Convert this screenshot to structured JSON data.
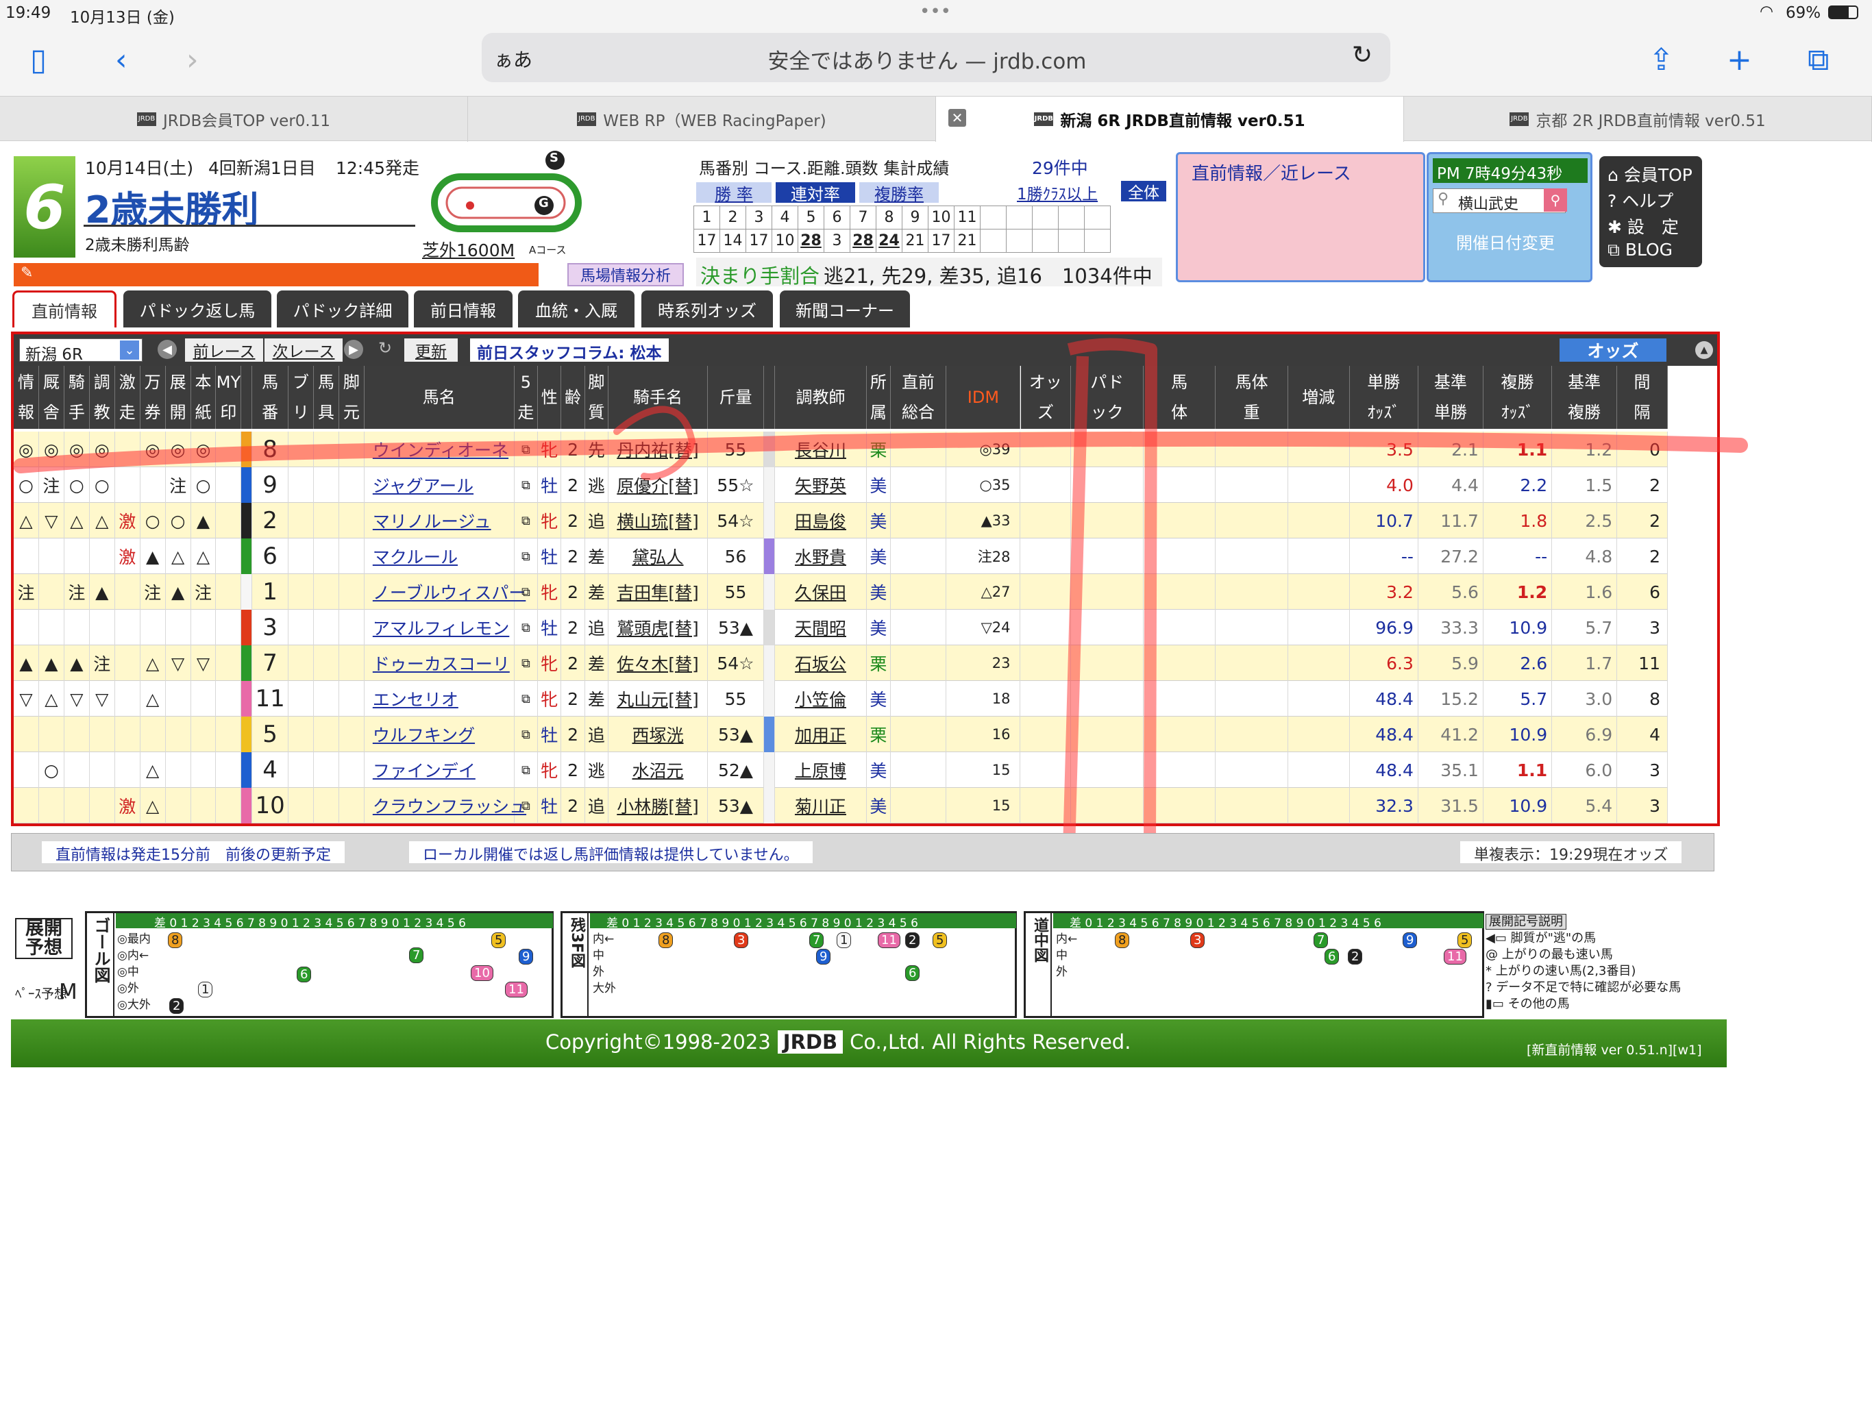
{
  "status": {
    "time": "19:49",
    "date": "10月13日 (金)",
    "battery": "69%",
    "dots": "•••"
  },
  "browser": {
    "aa": "ぁあ",
    "url": "安全ではありません — jrdb.com"
  },
  "tabs": [
    {
      "label": "JRDB会員TOP ver0.11"
    },
    {
      "label": "WEB RP（WEB RacingPaper)"
    },
    {
      "label": "新潟 6R JRDB直前情報 ver0.51"
    },
    {
      "label": "京都 2R JRDB直前情報 ver0.51"
    }
  ],
  "race": {
    "number": "6",
    "date_line": "10月14日(土)",
    "kai": "4回新潟1日目",
    "post": "12:45発走",
    "title": "2歳未勝利",
    "subtitle": "2歳未勝利馬齢",
    "course": "芝外1600M",
    "course_sub": "Aコース",
    "badge_s": "S",
    "badge_g": "G"
  },
  "stats": {
    "title": "馬番別 コース.距離.頭数 集計成績",
    "count": "29件中",
    "tab1": "勝 率",
    "tab2": "連対率",
    "tab3": "複勝率",
    "filter": "1勝ｸﾗｽ以上",
    "all": "全体",
    "row1": [
      "1",
      "2",
      "3",
      "4",
      "5",
      "6",
      "7",
      "8",
      "9",
      "10",
      "11",
      "",
      "",
      "",
      "",
      ""
    ],
    "row2": [
      "17",
      "14",
      "17",
      "10",
      "28",
      "3",
      "28",
      "24",
      "21",
      "17",
      "21",
      "",
      "",
      "",
      "",
      ""
    ],
    "analysis": "馬場情報分析",
    "kimarite": "決まり手割合",
    "kimarite_vals": "逃21, 先29, 差35, 追16　1034件中"
  },
  "side": {
    "pink_title": "直前情報／近レース",
    "clock": "PM 7時49分43秒",
    "search_value": "横山武史",
    "date_change": "開催日付変更",
    "menu": [
      "会員TOP",
      "ヘルプ",
      "設　定",
      "BLOG"
    ]
  },
  "page_tabs": [
    "直前情報",
    "パドック返し馬",
    "パドック詳細",
    "前日情報",
    "血統・入厩",
    "時系列オッズ",
    "新聞コーナー"
  ],
  "controls": {
    "race_select": "新潟 6R",
    "prev": "前レース",
    "next": "次レース",
    "refresh": "更新",
    "column": "前日スタッフコラム: 松本",
    "odds": "オッズ"
  },
  "headers": [
    [
      "情",
      "報"
    ],
    [
      "厩",
      "舎"
    ],
    [
      "騎",
      "手"
    ],
    [
      "調",
      "教"
    ],
    [
      "激",
      "走"
    ],
    [
      "万",
      "券"
    ],
    [
      "展",
      "開"
    ],
    [
      "本",
      "紙"
    ],
    [
      "MY",
      "印"
    ],
    [
      "",
      ""
    ],
    [
      "馬",
      "番"
    ],
    [
      "ブ",
      "リ"
    ],
    [
      "馬",
      "具"
    ],
    [
      "脚",
      "元"
    ],
    [
      "馬名",
      ""
    ],
    [
      "5",
      "走"
    ],
    [
      "性",
      ""
    ],
    [
      "齢",
      ""
    ],
    [
      "脚",
      "質"
    ],
    [
      "騎手名",
      ""
    ],
    [
      "斤量",
      ""
    ],
    [
      "",
      ""
    ],
    [
      "調教師",
      ""
    ],
    [
      "所",
      "属"
    ],
    [
      "直前",
      "総合"
    ],
    [
      "IDM",
      ""
    ],
    [
      "オッ",
      "ズ"
    ],
    [
      "パド",
      "ック"
    ],
    [
      "馬",
      "体"
    ],
    [
      "馬体",
      "重"
    ],
    [
      "増減",
      ""
    ],
    [
      "単勝",
      "ｵｯｽﾞ"
    ],
    [
      "基準",
      "単勝"
    ],
    [
      "複勝",
      "ｵｯｽﾞ"
    ],
    [
      "基準",
      "複勝"
    ],
    [
      "間",
      "隔"
    ]
  ],
  "horses": [
    {
      "marks": [
        "◎",
        "◎",
        "◎",
        "◎",
        "",
        "◎",
        "◎",
        "◎",
        ""
      ],
      "color": "#f0a020",
      "num": "8",
      "name": "ウインディオーネ",
      "sex": "牝",
      "age": "2",
      "style": "先",
      "jockey": "丹内祐[替]",
      "weight": "55",
      "tcolor": "#dcdcdc",
      "trainer": "長谷川",
      "affil": "栗",
      "idm": "◎39",
      "win": "3.5",
      "bwin": "2.1",
      "place": "1.1",
      "bplace": "1.2",
      "gap": "0"
    },
    {
      "marks": [
        "○",
        "注",
        "○",
        "○",
        "",
        "",
        "注",
        "○",
        ""
      ],
      "color": "#1e5fd0",
      "num": "9",
      "name": "ジャグアール",
      "sex": "牡",
      "age": "2",
      "style": "逃",
      "jockey": "原優介[替]",
      "weight": "55☆",
      "tcolor": "#f4f4f4",
      "trainer": "矢野英",
      "affil": "美",
      "idm": "○35",
      "win": "4.0",
      "bwin": "4.4",
      "place": "2.2",
      "bplace": "1.5",
      "gap": "2"
    },
    {
      "marks": [
        "△",
        "▽",
        "△",
        "△",
        "激",
        "○",
        "○",
        "▲",
        ""
      ],
      "color": "#222222",
      "num": "2",
      "name": "マリノルージュ",
      "sex": "牝",
      "age": "2",
      "style": "追",
      "jockey": "横山琉[替]",
      "weight": "54☆",
      "tcolor": "#f4f4f4",
      "trainer": "田島俊",
      "affil": "美",
      "idm": "▲33",
      "win": "10.7",
      "bwin": "11.7",
      "place": "1.8",
      "bplace": "2.5",
      "gap": "2"
    },
    {
      "marks": [
        "",
        "",
        "",
        "",
        "激",
        "▲",
        "△",
        "△",
        ""
      ],
      "color": "#2a9a2a",
      "num": "6",
      "name": "マクルール",
      "sex": "牡",
      "age": "2",
      "style": "差",
      "jockey": "黛弘人",
      "weight": "56",
      "tcolor": "#9b7fe0",
      "trainer": "水野貴",
      "affil": "美",
      "idm": "注28",
      "win": "--",
      "bwin": "27.2",
      "place": "--",
      "bplace": "4.8",
      "gap": "2"
    },
    {
      "marks": [
        "注",
        "",
        "注",
        "▲",
        "",
        "注",
        "▲",
        "注",
        ""
      ],
      "color": "#f6f6f6",
      "num": "1",
      "name": "ノーブルウィスパー",
      "sex": "牝",
      "age": "2",
      "style": "差",
      "jockey": "吉田隼[替]",
      "weight": "55",
      "tcolor": "#f4f4f4",
      "trainer": "久保田",
      "affil": "美",
      "idm": "△27",
      "win": "3.2",
      "bwin": "5.6",
      "place": "1.2",
      "bplace": "1.6",
      "gap": "6"
    },
    {
      "marks": [
        "",
        "",
        "",
        "",
        "",
        "",
        "",
        "",
        ""
      ],
      "color": "#e03a1a",
      "num": "3",
      "name": "アマルフィレモン",
      "sex": "牡",
      "age": "2",
      "style": "追",
      "jockey": "鷲頭虎[替]",
      "weight": "53▲",
      "tcolor": "#dcdcdc",
      "trainer": "天間昭",
      "affil": "美",
      "idm": "▽24",
      "win": "96.9",
      "bwin": "33.3",
      "place": "10.9",
      "bplace": "5.7",
      "gap": "3"
    },
    {
      "marks": [
        "▲",
        "▲",
        "▲",
        "注",
        "",
        "△",
        "▽",
        "▽",
        ""
      ],
      "color": "#2a9a2a",
      "num": "7",
      "name": "ドゥーカスコーリ",
      "sex": "牝",
      "age": "2",
      "style": "差",
      "jockey": "佐々木[替]",
      "weight": "54☆",
      "tcolor": "#f4f4f4",
      "trainer": "石坂公",
      "affil": "栗",
      "idm": "23",
      "win": "6.3",
      "bwin": "5.9",
      "place": "2.6",
      "bplace": "1.7",
      "gap": "11"
    },
    {
      "marks": [
        "▽",
        "△",
        "▽",
        "▽",
        "",
        "△",
        "",
        "",
        ""
      ],
      "color": "#e86aa8",
      "num": "11",
      "name": "エンセリオ",
      "sex": "牝",
      "age": "2",
      "style": "差",
      "jockey": "丸山元[替]",
      "weight": "55",
      "tcolor": "#f4f4f4",
      "trainer": "小笠倫",
      "affil": "美",
      "idm": "18",
      "win": "48.4",
      "bwin": "15.2",
      "place": "5.7",
      "bplace": "3.0",
      "gap": "8"
    },
    {
      "marks": [
        "",
        "",
        "",
        "",
        "",
        "",
        "",
        "",
        ""
      ],
      "color": "#f0c020",
      "num": "5",
      "name": "ウルフキング",
      "sex": "牡",
      "age": "2",
      "style": "追",
      "jockey": "西塚洸",
      "weight": "53▲",
      "tcolor": "#5b8de0",
      "trainer": "加用正",
      "affil": "栗",
      "idm": "16",
      "win": "48.4",
      "bwin": "41.2",
      "place": "10.9",
      "bplace": "6.9",
      "gap": "4"
    },
    {
      "marks": [
        "",
        "○",
        "",
        "",
        "",
        "△",
        "",
        "",
        ""
      ],
      "color": "#1e5fd0",
      "num": "4",
      "name": "ファインデイ",
      "sex": "牝",
      "age": "2",
      "style": "逃",
      "jockey": "水沼元",
      "weight": "52▲",
      "tcolor": "#f4f4f4",
      "trainer": "上原博",
      "affil": "美",
      "idm": "15",
      "win": "48.4",
      "bwin": "35.1",
      "place": "1.1",
      "bplace": "6.0",
      "gap": "3"
    },
    {
      "marks": [
        "",
        "",
        "",
        "",
        "激",
        "△",
        "",
        "",
        ""
      ],
      "color": "#e86aa8",
      "num": "10",
      "name": "クラウンフラッシュ",
      "sex": "牡",
      "age": "2",
      "style": "追",
      "jockey": "小林勝[替]",
      "weight": "53▲",
      "tcolor": "#f4f4f4",
      "trainer": "菊川正",
      "affil": "美",
      "idm": "15",
      "win": "32.3",
      "bwin": "31.5",
      "place": "10.9",
      "bplace": "5.4",
      "gap": "3"
    }
  ],
  "notes": {
    "n1": "直前情報は発走15分前　前後の更新予定",
    "n2": "ローカル開催では返し馬評価情報は提供していません。",
    "n3": "単複表示：19:29現在オッズ"
  },
  "diagram": {
    "tenkai": "展開予想",
    "pace_label": "ﾍﾟｰｽ予想",
    "pace": "M",
    "goal_title": "ゴール図",
    "zan_title": "残3F図",
    "dochu_title": "道中図",
    "goal_rows": [
      "◎最内",
      "◎内←",
      "◎中",
      "◎外",
      "◎大外"
    ],
    "zan_rows": [
      "内←",
      "中",
      "外",
      "大外"
    ],
    "dochu_rows": [
      "内←",
      "中",
      "外"
    ],
    "scale_head": "差 0 1 2 3 4 5 6 7 8 9 0 1 2 3 4 5 6 7 8 9 0 1 2 3 4 5 6",
    "legend_title": "展開記号説明",
    "legend": [
      "脚質が\"逃\"の馬",
      "上がりの最も速い馬",
      "上がりの速い馬(2,3番目)",
      "データ不足で特に確認が必要な馬",
      "その他の馬"
    ]
  },
  "footer": {
    "copyright": "Copyright©1998-2023",
    "brand": "JRDB",
    "rest": "Co.,Ltd. All Rights Reserved.",
    "version": "[新直前情報 ver 0.51.n][w1]"
  }
}
